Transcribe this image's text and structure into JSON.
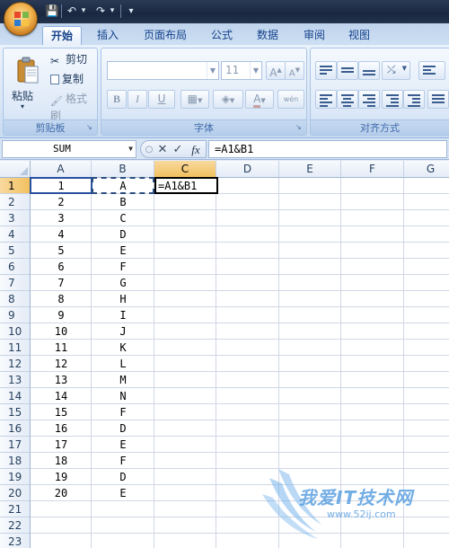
{
  "quick_access": {
    "save": "💾",
    "undo": "↶",
    "redo": "↷",
    "customize": "▾"
  },
  "tabs": [
    "开始",
    "插入",
    "页面布局",
    "公式",
    "数据",
    "审阅",
    "视图"
  ],
  "ribbon": {
    "clipboard": {
      "paste": "粘贴",
      "cut": "剪切",
      "copy": "复制",
      "format_painter": "格式刷",
      "label": "剪贴板"
    },
    "font": {
      "font_name": "",
      "font_size": "11",
      "grow": "A",
      "shrink": "A",
      "bold": "B",
      "italic": "I",
      "underline": "U",
      "phonetic": "wén",
      "label": "字体"
    },
    "alignment": {
      "label": "对齐方式"
    }
  },
  "formula_bar": {
    "name_box": "SUM",
    "cancel": "✕",
    "enter": "✓",
    "fx": "fx",
    "formula": "=A1&B1"
  },
  "grid": {
    "columns": [
      "A",
      "B",
      "C",
      "D",
      "E",
      "F",
      "G"
    ],
    "rows": [
      "1",
      "2",
      "3",
      "4",
      "5",
      "6",
      "7",
      "8",
      "9",
      "10",
      "11",
      "12",
      "13",
      "14",
      "15",
      "16",
      "17",
      "18",
      "19",
      "20",
      "21",
      "22",
      "23"
    ],
    "col_a": [
      "1",
      "2",
      "3",
      "4",
      "5",
      "6",
      "7",
      "8",
      "9",
      "10",
      "11",
      "12",
      "13",
      "14",
      "15",
      "16",
      "17",
      "18",
      "19",
      "20"
    ],
    "col_b": [
      "A",
      "B",
      "C",
      "D",
      "E",
      "F",
      "G",
      "H",
      "I",
      "J",
      "K",
      "L",
      "M",
      "N",
      "F",
      "D",
      "E",
      "F",
      "D",
      "E"
    ],
    "active_cell_text": "=A1&B1"
  },
  "watermark": {
    "title": "我爱IT技术网",
    "url": "www.52ij.com"
  }
}
